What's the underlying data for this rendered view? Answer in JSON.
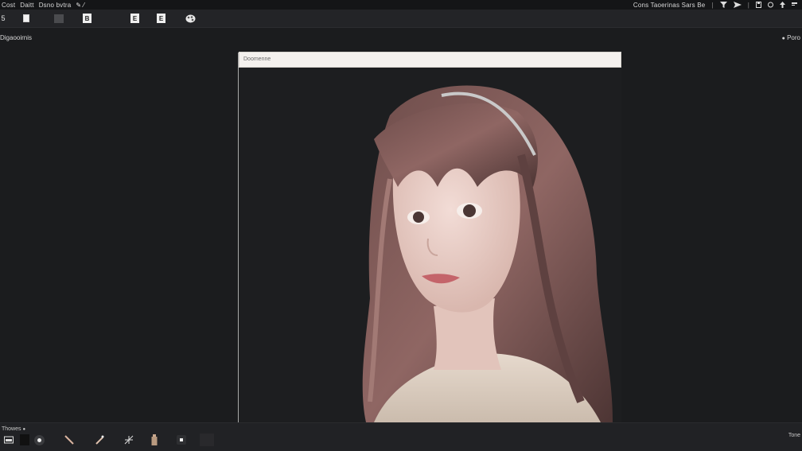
{
  "menubar": {
    "left_items": [
      "Cost",
      "Daitt",
      "Dsno bvtra"
    ],
    "left_symbol": "✎ ⁄",
    "right_text": "Cons Taoerinas Sars Be",
    "right_icons": [
      "filter-icon",
      "send-icon",
      "save-icon",
      "reset-icon",
      "upload-icon",
      "menu-icon"
    ]
  },
  "toolbar": {
    "items": [
      {
        "name": "tool-5",
        "label": "5"
      },
      {
        "name": "tool-layer",
        "icon": "layer-icon"
      },
      {
        "name": "tool-swatch",
        "icon": "swatch-icon"
      },
      {
        "name": "tool-doc-b",
        "label": "B"
      },
      {
        "name": "tool-doc-e1",
        "label": "E"
      },
      {
        "name": "tool-doc-e2",
        "label": "E"
      },
      {
        "name": "tool-palette",
        "icon": "palette-icon"
      }
    ]
  },
  "panel": {
    "left_label": "Digaooirnis",
    "right_label": "Poro"
  },
  "canvas": {
    "header_label": "Doomenne"
  },
  "bottom": {
    "label": "Thowes",
    "right_label": "Tone",
    "tools": [
      "media-icon",
      "dark-swatch-icon",
      "pointer-icon",
      "brush-icon",
      "pen-icon",
      "sparkle-icon",
      "bottle-icon",
      "stamp-icon",
      "blank-swatch-icon"
    ]
  }
}
